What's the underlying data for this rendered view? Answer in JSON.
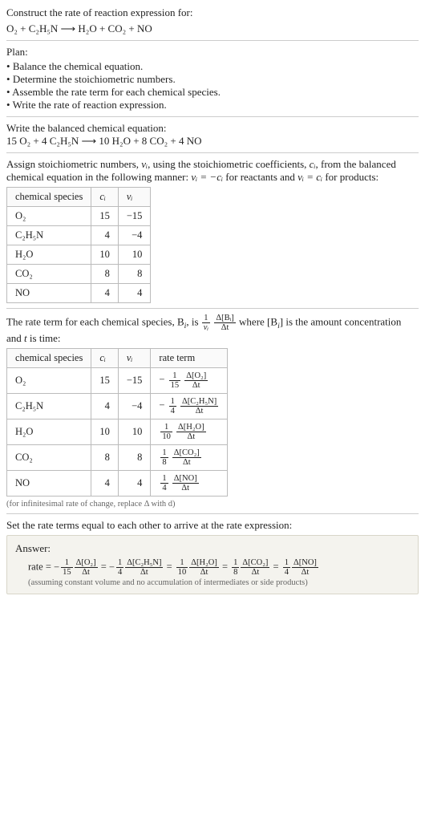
{
  "chart_data": {
    "type": "table",
    "title": "Rate of reaction derivation",
    "tables": [
      {
        "name": "stoichiometric numbers",
        "columns": [
          "chemical species",
          "c_i",
          "ν_i"
        ],
        "rows": [
          [
            "O2",
            15,
            -15
          ],
          [
            "C2H5N",
            4,
            -4
          ],
          [
            "H2O",
            10,
            10
          ],
          [
            "CO2",
            8,
            8
          ],
          [
            "NO",
            4,
            4
          ]
        ]
      },
      {
        "name": "rate terms",
        "columns": [
          "chemical species",
          "c_i",
          "ν_i",
          "rate term"
        ],
        "rows": [
          [
            "O2",
            15,
            -15,
            "-(1/15) Δ[O2]/Δt"
          ],
          [
            "C2H5N",
            4,
            -4,
            "-(1/4) Δ[C2H5N]/Δt"
          ],
          [
            "H2O",
            10,
            10,
            "(1/10) Δ[H2O]/Δt"
          ],
          [
            "CO2",
            8,
            8,
            "(1/8) Δ[CO2]/Δt"
          ],
          [
            "NO",
            4,
            4,
            "(1/4) Δ[NO]/Δt"
          ]
        ]
      }
    ]
  },
  "header": {
    "prompt": "Construct the rate of reaction expression for:",
    "reaction": "O₂ + C₂H₅N  ⟶  H₂O + CO₂ + NO"
  },
  "plan": {
    "heading": "Plan:",
    "items": [
      "Balance the chemical equation.",
      "Determine the stoichiometric numbers.",
      "Assemble the rate term for each chemical species.",
      "Write the rate of reaction expression."
    ]
  },
  "balanced": {
    "heading": "Write the balanced chemical equation:",
    "equation": "15 O₂ + 4 C₂H₅N  ⟶  10 H₂O + 8 CO₂ + 4 NO"
  },
  "stoich": {
    "intro_a": "Assign stoichiometric numbers, ",
    "intro_b": ", using the stoichiometric coefficients, ",
    "intro_c": ", from the balanced chemical equation in the following manner: ",
    "intro_d": " for reactants and ",
    "intro_e": " for products:",
    "nu_i": "νᵢ",
    "c_i": "cᵢ",
    "rel_react": "νᵢ = −cᵢ",
    "rel_prod": "νᵢ = cᵢ",
    "col_species": "chemical species",
    "col_c": "cᵢ",
    "col_nu": "νᵢ",
    "rows": [
      {
        "sp": "O₂",
        "c": "15",
        "nu": "−15"
      },
      {
        "sp": "C₂H₅N",
        "c": "4",
        "nu": "−4"
      },
      {
        "sp": "H₂O",
        "c": "10",
        "nu": "10"
      },
      {
        "sp": "CO₂",
        "c": "8",
        "nu": "8"
      },
      {
        "sp": "NO",
        "c": "4",
        "nu": "4"
      }
    ]
  },
  "rate_term": {
    "intro_a": "The rate term for each chemical species, B",
    "intro_b": ", is ",
    "intro_c": " where [B",
    "intro_d": "] is the amount concentration and ",
    "t": "t",
    "intro_e": " is time:",
    "sub_i": "i",
    "one": "1",
    "nu_i": "νᵢ",
    "dB": "Δ[Bᵢ]",
    "dt": "Δt",
    "col_species": "chemical species",
    "col_c": "cᵢ",
    "col_nu": "νᵢ",
    "col_rate": "rate term",
    "rows": [
      {
        "sp": "O₂",
        "c": "15",
        "nu": "−15",
        "neg": "−",
        "a": "1",
        "b": "15",
        "top": "Δ[O₂]",
        "bot": "Δt"
      },
      {
        "sp": "C₂H₅N",
        "c": "4",
        "nu": "−4",
        "neg": "−",
        "a": "1",
        "b": "4",
        "top": "Δ[C₂H₅N]",
        "bot": "Δt"
      },
      {
        "sp": "H₂O",
        "c": "10",
        "nu": "10",
        "neg": "",
        "a": "1",
        "b": "10",
        "top": "Δ[H₂O]",
        "bot": "Δt"
      },
      {
        "sp": "CO₂",
        "c": "8",
        "nu": "8",
        "neg": "",
        "a": "1",
        "b": "8",
        "top": "Δ[CO₂]",
        "bot": "Δt"
      },
      {
        "sp": "NO",
        "c": "4",
        "nu": "4",
        "neg": "",
        "a": "1",
        "b": "4",
        "top": "Δ[NO]",
        "bot": "Δt"
      }
    ],
    "footnote": "(for infinitesimal rate of change, replace Δ with d)"
  },
  "final": {
    "heading": "Set the rate terms equal to each other to arrive at the rate expression:",
    "answer_label": "Answer:",
    "rate_lhs": "rate = ",
    "eq": " = ",
    "terms": [
      {
        "neg": "−",
        "a": "1",
        "b": "15",
        "top": "Δ[O₂]",
        "bot": "Δt"
      },
      {
        "neg": "−",
        "a": "1",
        "b": "4",
        "top": "Δ[C₂H₅N]",
        "bot": "Δt"
      },
      {
        "neg": "",
        "a": "1",
        "b": "10",
        "top": "Δ[H₂O]",
        "bot": "Δt"
      },
      {
        "neg": "",
        "a": "1",
        "b": "8",
        "top": "Δ[CO₂]",
        "bot": "Δt"
      },
      {
        "neg": "",
        "a": "1",
        "b": "4",
        "top": "Δ[NO]",
        "bot": "Δt"
      }
    ],
    "note": "(assuming constant volume and no accumulation of intermediates or side products)"
  }
}
